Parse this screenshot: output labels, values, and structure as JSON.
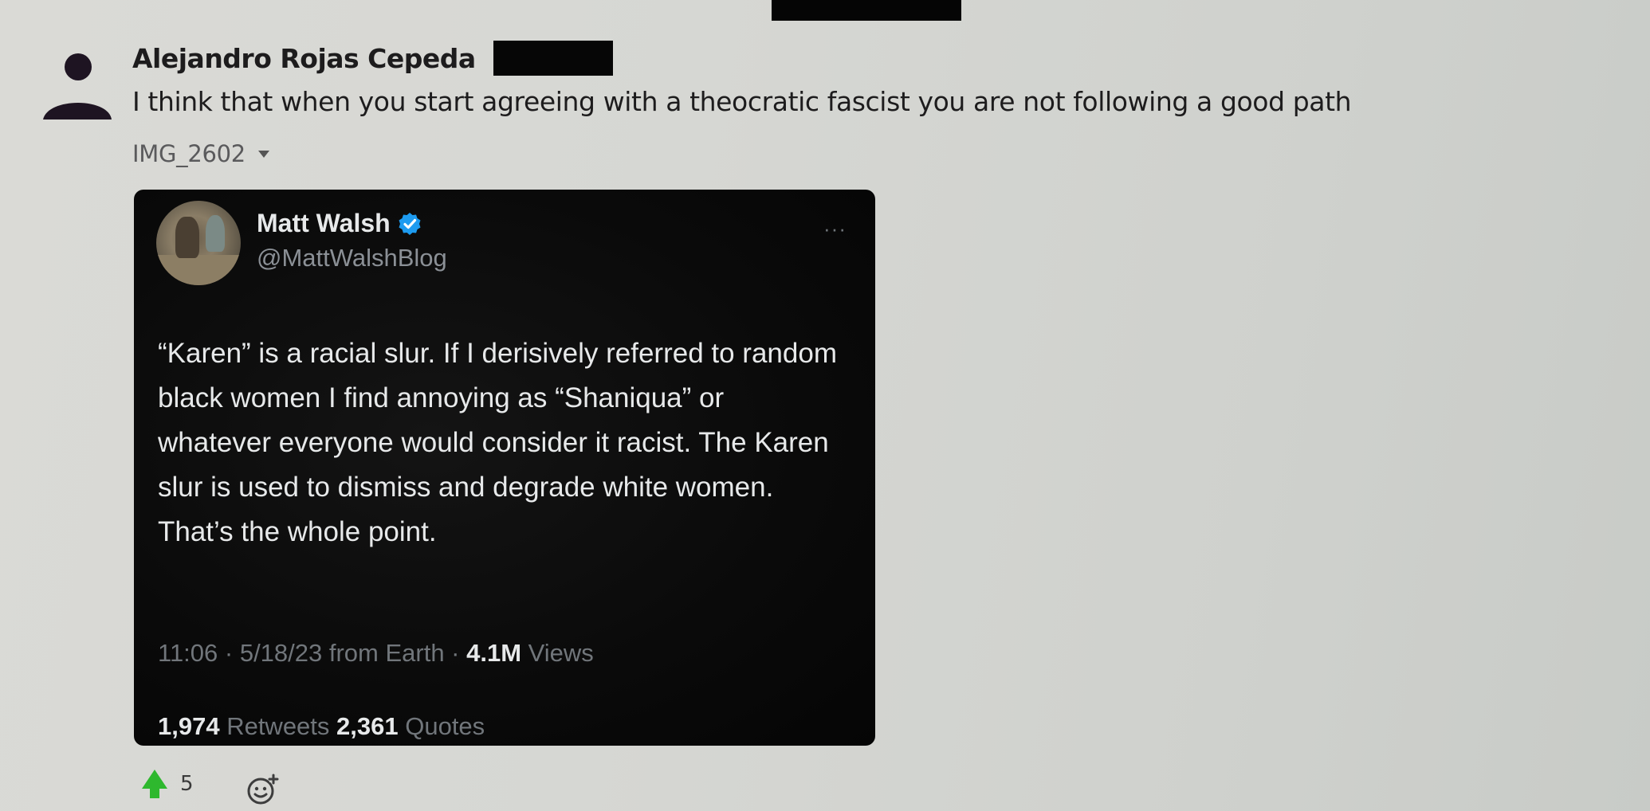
{
  "message": {
    "author_name": "Alejandro Rojas Cepeda",
    "text": "I think that when you start agreeing with a theocratic fascist you are not following a good path",
    "attachment_name": "IMG_2602"
  },
  "tweet": {
    "name": "Matt Walsh",
    "handle": "@MattWalshBlog",
    "more_label": "···",
    "body": "“Karen” is a racial slur. If I derisively referred to random black women I find annoying as “Shaniqua” or whatever everyone would consider it racist. The Karen slur is used to dismiss and degrade white women. That’s the whole point.",
    "meta_prefix": "11:06 · 5/18/23 from Earth · ",
    "views_count": "4.1M",
    "views_label": " Views",
    "retweets_count": "1,974",
    "retweets_label": " Retweets  ",
    "quotes_count": "2,361",
    "quotes_label": " Quotes"
  },
  "reactions": {
    "emoji": "green-triangle-up-icon",
    "count": "5"
  },
  "colors": {
    "tweet_bg": "#0a0a0a",
    "verified": "#1d9bf0",
    "reaction_green": "#2eb82e",
    "page_bg": "#d6d7d3"
  }
}
